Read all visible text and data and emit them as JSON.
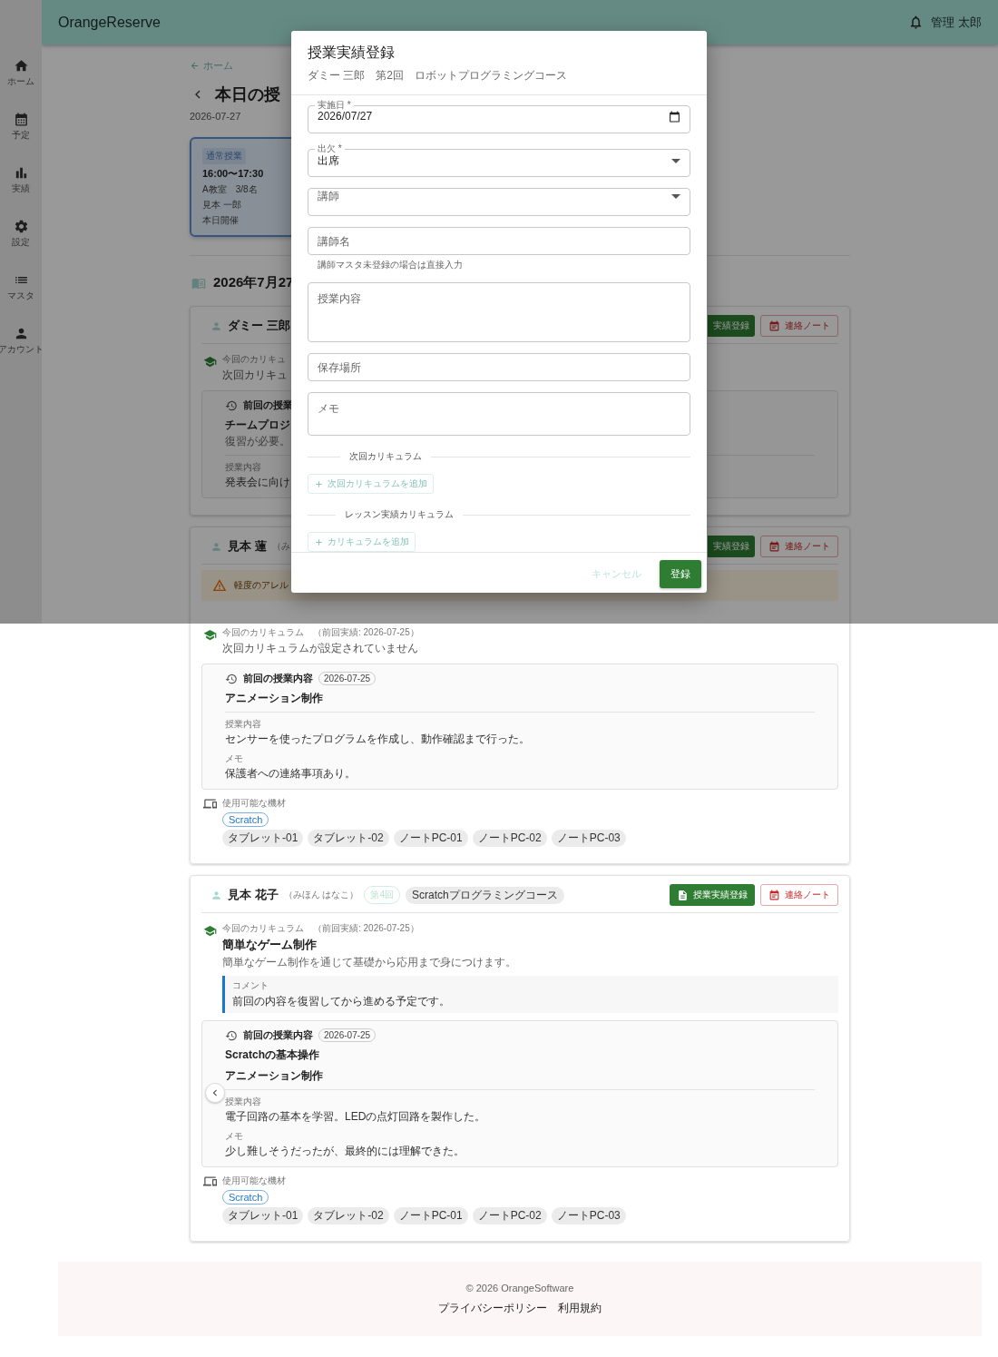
{
  "app": {
    "title": "OrangeReserve",
    "user": "管理 太郎"
  },
  "nav": [
    {
      "label": "ホーム"
    },
    {
      "label": "予定"
    },
    {
      "label": "実績"
    },
    {
      "label": "設定"
    },
    {
      "label": "マスタ"
    },
    {
      "label": "アカウント"
    }
  ],
  "breadcrumb": "ホーム",
  "page": {
    "title": "本日の授",
    "date": "2026-07-27"
  },
  "lesson": {
    "tag": "通常授業",
    "time": "16:00〜17:30",
    "room": "A教室　3/8名",
    "teacher": "見本 一郎",
    "status": "本日開催",
    "selected": true
  },
  "section_title": "2026年7月27",
  "students": [
    {
      "name": "ダミー 三郎",
      "actions": [
        {
          "label": "実績登録",
          "kind": "record",
          "cut": true
        },
        {
          "label": "連絡ノート",
          "kind": "note",
          "cut": false
        }
      ],
      "curriculum": {
        "label": "今回のカリキュ",
        "text": "次回カリキュ"
      },
      "previous": {
        "heading": "前回の授業",
        "titles": [
          "チームプロジ"
        ],
        "subtitle": "復習が必要。",
        "fields": [
          {
            "label": "授業内容",
            "text": "発表会に向け"
          }
        ]
      }
    },
    {
      "name": "見本 蓮",
      "reading": "（み",
      "actions": [
        {
          "label": "実績登録",
          "kind": "record",
          "cut": true
        },
        {
          "label": "連絡ノート",
          "kind": "note",
          "cut": false
        }
      ],
      "alert": "軽度のアレル",
      "curriculum": {
        "label": "今回のカリキュラム",
        "note": "（前回実績: 2026-07-25）",
        "text": "次回カリキュラムが設定されていません"
      },
      "previous": {
        "heading": "前回の授業内容",
        "date": "2026-07-25",
        "titles": [
          "アニメーション制作"
        ],
        "fields": [
          {
            "label": "授業内容",
            "text": "センサーを使ったプログラムを作成し、動作確認まで行った。"
          },
          {
            "label": "メモ",
            "text": "保護者への連絡事項あり。"
          }
        ]
      },
      "equipment": {
        "label": "使用可能な機材",
        "software": [
          "Scratch"
        ],
        "devices": [
          "タブレット-01",
          "タブレット-02",
          "ノートPC-01",
          "ノートPC-02",
          "ノートPC-03"
        ]
      }
    },
    {
      "name": "見本 花子",
      "reading": "（みほん はなこ）",
      "lesson_no": "第4回",
      "course": "Scratchプログラミングコース",
      "actions": [
        {
          "label": "授業実績登録",
          "kind": "record",
          "cut": false
        },
        {
          "label": "連絡ノート",
          "kind": "note",
          "cut": false
        }
      ],
      "curriculum": {
        "label": "今回のカリキュラム",
        "note": "（前回実績: 2026-07-25）",
        "title": "簡単なゲーム制作",
        "text": "簡単なゲーム制作を通じて基礎から応用まで身につけます。",
        "comment_label": "コメント",
        "comment": "前回の内容を復習してから進める予定です。"
      },
      "previous": {
        "heading": "前回の授業内容",
        "date": "2026-07-25",
        "titles": [
          "Scratchの基本操作",
          "アニメーション制作"
        ],
        "toggle": true,
        "fields": [
          {
            "label": "授業内容",
            "text": "電子回路の基本を学習。LEDの点灯回路を製作した。"
          },
          {
            "label": "メモ",
            "text": "少し難しそうだったが、最終的には理解できた。"
          }
        ]
      },
      "equipment": {
        "label": "使用可能な機材",
        "software": [
          "Scratch"
        ],
        "devices": [
          "タブレット-01",
          "タブレット-02",
          "ノートPC-01",
          "ノートPC-02",
          "ノートPC-03"
        ]
      }
    }
  ],
  "footer": {
    "copyright": "© 2026 OrangeSoftware",
    "links": [
      "プライバシーポリシー",
      "利用規約"
    ]
  },
  "dialog": {
    "title": "授業実績登録",
    "subtitle": "ダミー 三郎　第2回　ロボットプログラミングコース",
    "fields": [
      {
        "kind": "date",
        "label": "実施日 *",
        "value": "2026/07/27"
      },
      {
        "kind": "select",
        "label": "出欠 *",
        "value": "出席"
      },
      {
        "kind": "select",
        "placeholder": "講師"
      },
      {
        "kind": "text",
        "placeholder": "講師名",
        "helper": "講師マスタ未登録の場合は直接入力"
      },
      {
        "kind": "textarea",
        "placeholder": "授業内容"
      },
      {
        "kind": "text",
        "placeholder": "保存場所"
      },
      {
        "kind": "memo",
        "placeholder": "メモ"
      }
    ],
    "sections": [
      {
        "title": "次回カリキュラム",
        "button": "次回カリキュラムを追加",
        "disabled": true
      },
      {
        "title": "レッスン実績カリキュラム",
        "button": "カリキュラムを追加",
        "disabled": true
      }
    ],
    "buttons": [
      {
        "label": "キャンセル",
        "kind": "text"
      },
      {
        "label": "登録",
        "kind": "primary"
      }
    ]
  }
}
